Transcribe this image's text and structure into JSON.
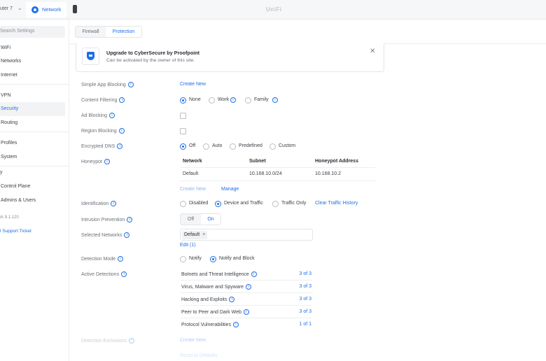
{
  "topbar": {
    "gateway_label": "uter 7",
    "app_tab_label": "Network",
    "brand": "UniFi"
  },
  "sidebar": {
    "search_placeholder": "Search Settings",
    "items": [
      {
        "label": "WiFi"
      },
      {
        "label": "Networks"
      },
      {
        "label": "Internet"
      },
      {
        "label": "VPN"
      },
      {
        "label": "Security"
      },
      {
        "label": "Routing"
      },
      {
        "label": "Profiles"
      },
      {
        "label": "System"
      },
      {
        "label": "Control Plane"
      },
      {
        "label": "Admins & Users"
      }
    ],
    "section_marker": "y",
    "version": "rk 9.1.120",
    "support_link": "l Support Ticket"
  },
  "tabs": {
    "firewall": "Firewall",
    "protection": "Protection"
  },
  "banner": {
    "title": "Upgrade to CyberSecure by Proofpoint",
    "subtitle": "Can be activated by the owner of this site.",
    "close": "✕"
  },
  "app_blocking": {
    "label": "Simple App Blocking",
    "action": "Create New"
  },
  "content_filtering": {
    "label": "Content Filtering",
    "options": [
      "None",
      "Work",
      "Family"
    ],
    "selected": "None"
  },
  "ad_blocking": {
    "label": "Ad Blocking"
  },
  "region_blocking": {
    "label": "Region Blocking"
  },
  "encrypted_dns": {
    "label": "Encrypted DNS",
    "options": [
      "Off",
      "Auto",
      "Predefined",
      "Custom"
    ],
    "selected": "Off"
  },
  "honeypot": {
    "label": "Honeypot",
    "columns": [
      "Network",
      "Subnet",
      "Honeypot Address"
    ],
    "rows": [
      {
        "network": "Default",
        "subnet": "10.168.10.0/24",
        "address": "10.168.10.2"
      }
    ],
    "create": "Create New",
    "manage": "Manage"
  },
  "identification": {
    "label": "Identification",
    "options": [
      "Disabled",
      "Device and Traffic",
      "Traffic Only"
    ],
    "selected": "Device and Traffic",
    "history_link": "Clear Traffic History"
  },
  "intrusion_prevention": {
    "label": "Intrusion Prevention",
    "off": "Off",
    "on": "On",
    "state": "On"
  },
  "selected_networks": {
    "label": "Selected Networks",
    "chip": "Default",
    "chip_remove": "×",
    "edit": "Edit (1)"
  },
  "detection_mode": {
    "label": "Detection Mode",
    "options": [
      "Notify",
      "Notify and Block"
    ],
    "selected": "Notify and Block"
  },
  "active_detections": {
    "label": "Active Detections",
    "rows": [
      {
        "name": "Botnets and Threat Intelligence",
        "count": "3 of 3"
      },
      {
        "name": "Virus, Malware and Spyware",
        "count": "3 of 3"
      },
      {
        "name": "Hacking and Exploits",
        "count": "3 of 3"
      },
      {
        "name": "Peer to Peer and Dark Web",
        "count": "3 of 3"
      },
      {
        "name": "Protocol Vulnerabilities",
        "count": "1 of 1"
      }
    ]
  },
  "detection_exclusions": {
    "label": "Detection Exclusions",
    "action": "Create New",
    "reset": "Reset to Defaults"
  },
  "colors": {
    "accent": "#1f6fe5",
    "sidebar_active_bg": "#f2f3f5",
    "text": "#3b3f45",
    "muted": "#6b7079"
  }
}
